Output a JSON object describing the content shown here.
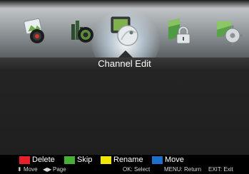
{
  "menu": {
    "icons": [
      {
        "name": "picture-icon",
        "active": false
      },
      {
        "name": "sound-icon",
        "active": false
      },
      {
        "name": "channel-icon",
        "active": true
      },
      {
        "name": "lock-icon",
        "active": false
      },
      {
        "name": "setup-icon",
        "active": false
      }
    ]
  },
  "title": "Channel Edit",
  "legend": [
    {
      "label": "Delete",
      "color": "#e8202a"
    },
    {
      "label": "Skip",
      "color": "#45b035"
    },
    {
      "label": "Rename",
      "color": "#f2e600"
    },
    {
      "label": "Move",
      "color": "#1e6fc8"
    }
  ],
  "help": {
    "move_label": "Move",
    "page_label": "Page",
    "select": "OK: Select",
    "return": "MENU: Return",
    "exit": "EXIT: Exit"
  }
}
